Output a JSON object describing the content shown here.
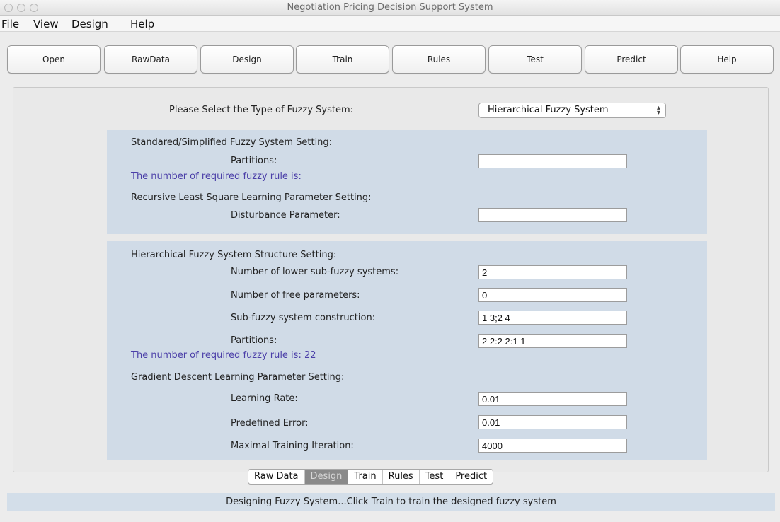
{
  "window": {
    "title": "Negotiation Pricing Decision Support System"
  },
  "menu": [
    "File",
    "View",
    "Design",
    "Help"
  ],
  "toolbar": [
    "Open",
    "RawData",
    "Design",
    "Train",
    "Rules",
    "Test",
    "Predict",
    "Help"
  ],
  "fuzzy_type": {
    "label": "Please Select the Type of Fuzzy System:",
    "selected": "Hierarchical Fuzzy System"
  },
  "standard": {
    "heading": "Standared/Simplified Fuzzy System Setting:",
    "partitions_label": "Partitions:",
    "partitions_value": "",
    "rule_count": "The number of required fuzzy rule is:",
    "rls_heading": "Recursive Least Square Learning Parameter Setting:",
    "disturbance_label": "Disturbance Parameter:",
    "disturbance_value": ""
  },
  "hierarchical": {
    "heading": "Hierarchical Fuzzy System Structure Setting:",
    "lower_label": "Number of lower sub-fuzzy systems:",
    "lower_value": "2",
    "free_label": "Number of free parameters:",
    "free_value": "0",
    "construction_label": "Sub-fuzzy system construction:",
    "construction_value": "1 3;2 4",
    "partitions_label": "Partitions:",
    "partitions_value": "2 2:2 2:1 1",
    "rule_count": "The number of required fuzzy rule is: 22",
    "gd_heading": "Gradient Descent Learning Parameter Setting:",
    "lr_label": "Learning Rate:",
    "lr_value": "0.01",
    "error_label": "Predefined Error:",
    "error_value": "0.01",
    "iter_label": "Maximal Training Iteration:",
    "iter_value": "4000"
  },
  "tabs": {
    "items": [
      "Raw Data",
      "Design",
      "Train",
      "Rules",
      "Test",
      "Predict"
    ],
    "active": "Design"
  },
  "status": "Designing Fuzzy System...Click Train to train the designed fuzzy system",
  "colors": {
    "section_bg": "#d0dbe7",
    "rule_text": "#4b3fa8",
    "status_bg": "#d3dee9"
  }
}
